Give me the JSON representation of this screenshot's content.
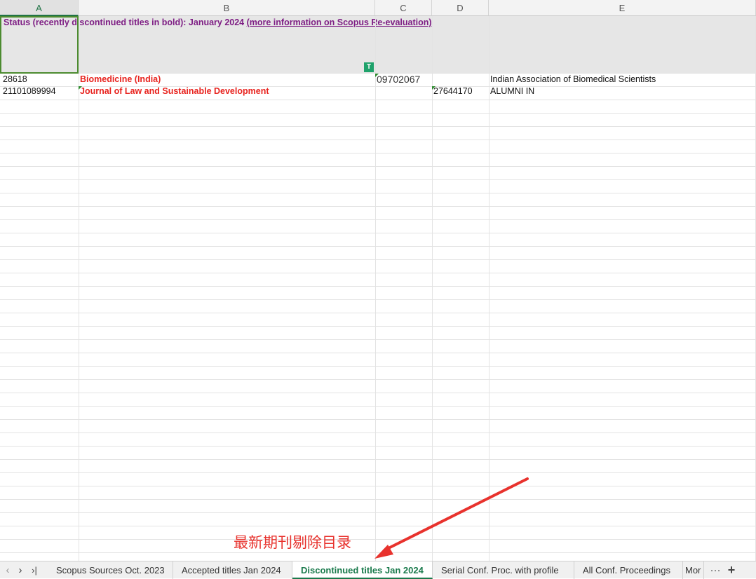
{
  "columns": [
    "A",
    "B",
    "C",
    "D",
    "E"
  ],
  "header_row": {
    "status_text": "Status (recently discontinued titles in bold):  January 2024 ",
    "link_text": "(more information on Scopus Re-evaluation)"
  },
  "rows": [
    {
      "id": "28618",
      "title": "Biomedicine (India)",
      "issn": "09702067",
      "eissn": "",
      "publisher": "Indian Association of Biomedical Scientists"
    },
    {
      "id": "21101089994",
      "title": "Journal of Law and Sustainable Development",
      "issn": "",
      "eissn": "27644170",
      "publisher": "ALUMNI IN"
    }
  ],
  "fill_handle_glyph": "T",
  "tabs": {
    "nav_prev": "‹",
    "nav_next": "›",
    "nav_last": "›|",
    "items": [
      "Scopus Sources Oct. 2023",
      "Accepted titles Jan 2024",
      "Discontinued titles Jan 2024",
      "Serial Conf. Proc. with profile",
      "All Conf. Proceedings",
      "Mor"
    ],
    "active_index": 2,
    "more_label": "···",
    "add_label": "+"
  },
  "annotation": {
    "text": "最新期刊剔除目录",
    "color": "#e8322d"
  },
  "colors": {
    "accent": "#217346",
    "status_purple": "#7e1e84",
    "title_red": "#e8231e",
    "selection_border": "#4c8b30"
  }
}
